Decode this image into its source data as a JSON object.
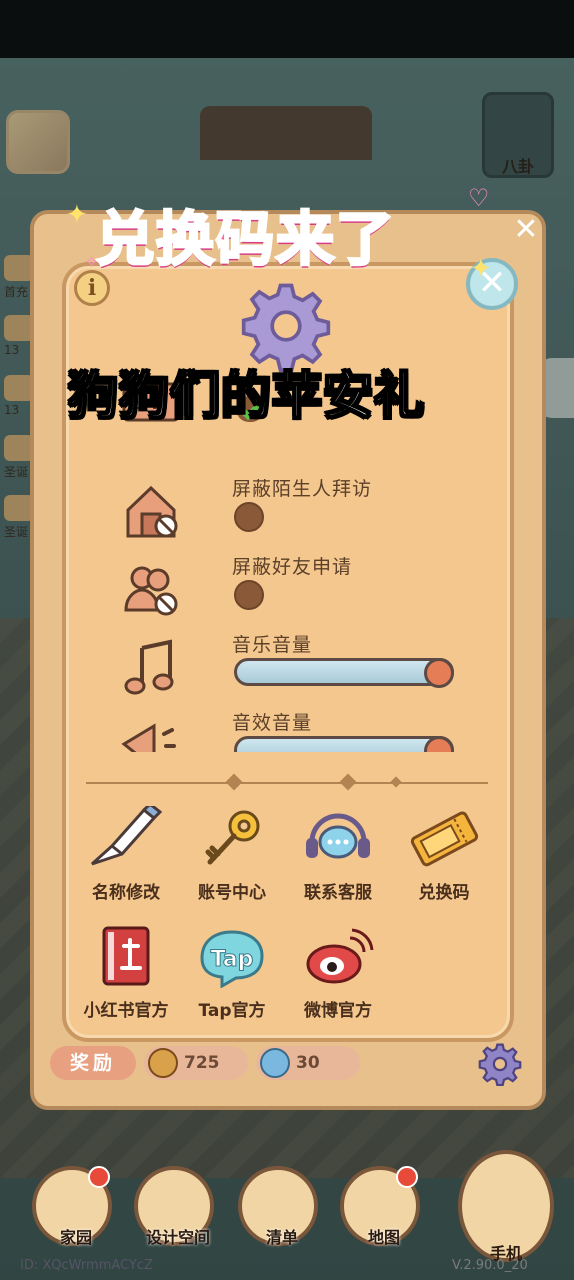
{
  "overlay": {
    "title": "兑换码来了",
    "subtitle": "狗狗们的苹安礼"
  },
  "background_hud": {
    "left_items": [
      "首充",
      "13",
      "13",
      "圣诞",
      "圣诞"
    ],
    "top_right_label": "八卦"
  },
  "settings_panel": {
    "rows": [
      {
        "label": "屏蔽陌生人拜访",
        "control": "toggle",
        "state": "off"
      },
      {
        "label": "屏蔽好友申请",
        "control": "toggle",
        "state": "off"
      },
      {
        "label": "音乐音量",
        "control": "slider",
        "value_pct": 100
      },
      {
        "label": "音效音量",
        "control": "slider",
        "value_pct": 100
      }
    ],
    "top_row_state": "checked"
  },
  "actions": [
    {
      "label": "名称修改",
      "icon": "pencil-icon"
    },
    {
      "label": "账号中心",
      "icon": "key-icon"
    },
    {
      "label": "联系客服",
      "icon": "headset-icon"
    },
    {
      "label": "兑换码",
      "icon": "ticket-icon"
    },
    {
      "label": "小红书官方",
      "icon": "xiaohongshu-icon"
    },
    {
      "label": "Tap官方",
      "icon": "taptap-icon"
    },
    {
      "label": "微博官方",
      "icon": "weibo-icon"
    }
  ],
  "reward_bar": {
    "label": "奖励",
    "currency1": "725",
    "currency2": "30"
  },
  "bottom_nav": [
    {
      "label": "家园"
    },
    {
      "label": "设计空间"
    },
    {
      "label": "清单"
    },
    {
      "label": "地图"
    },
    {
      "label": "手机"
    }
  ],
  "footer": {
    "id": "ID: XQcWrmmACYcZ",
    "version": "V.2.90.0_20"
  },
  "colors": {
    "panel": "#f4c78f",
    "title_pink": "#ff5fa8",
    "accent_red": "#e57d57"
  }
}
